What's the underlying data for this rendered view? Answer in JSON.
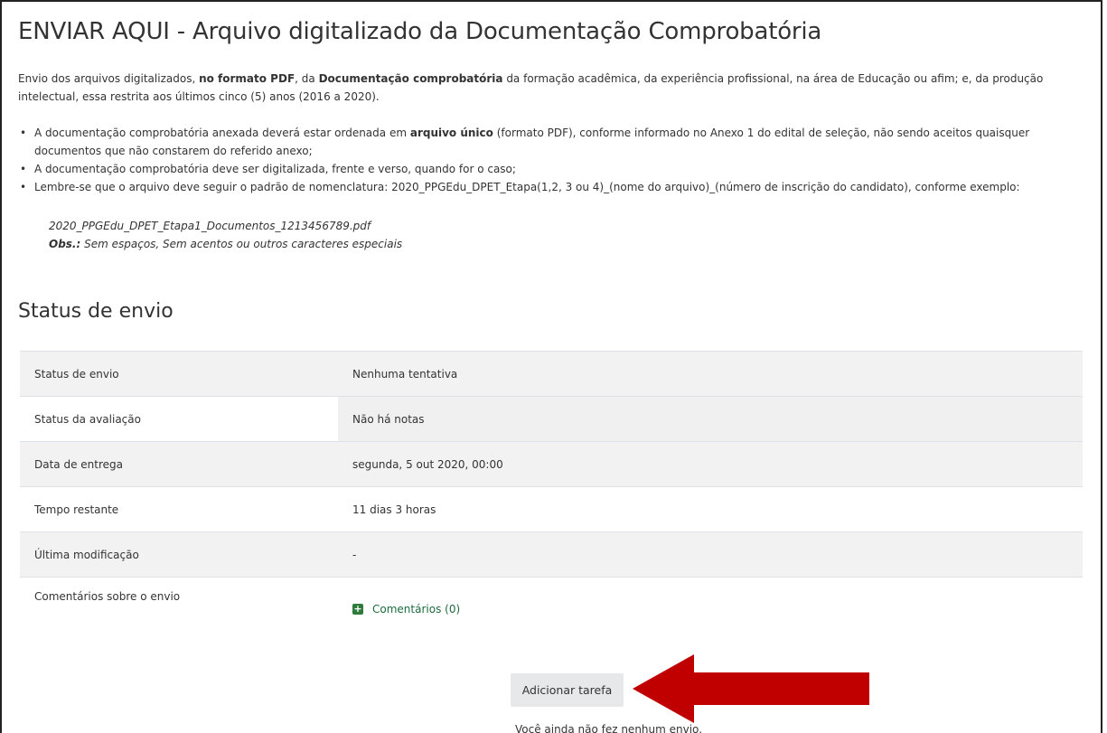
{
  "page": {
    "title": "ENVIAR AQUI - Arquivo digitalizado da Documentação Comprobatória"
  },
  "intro": {
    "part1": "Envio dos arquivos digitalizados, ",
    "bold1": "no formato PDF",
    "part2": ", da ",
    "bold2": "Documentação comprobatória",
    "part3": " da formação acadêmica, da experiência profissional, na área de Educação ou afim; e, da produção intelectual, essa restrita aos últimos cinco (5) anos (2016 a 2020)."
  },
  "bullets": {
    "b1_part1": "A documentação comprobatória anexada deverá estar ordenada em ",
    "b1_bold": "arquivo único",
    "b1_part2": " (formato PDF), conforme informado no Anexo 1 do edital de seleção, não sendo aceitos quaisquer documentos que não constarem do referido anexo;",
    "b2": "A documentação comprobatória deve ser digitalizada, frente e verso, quando for o caso;",
    "b3": "Lembre-se que o arquivo deve seguir o padrão de nomenclatura: 2020_PPGEdu_DPET_Etapa(1,2, 3 ou 4)_(nome do arquivo)_(número de inscrição do candidato), conforme exemplo:"
  },
  "example": {
    "filename": "2020_PPGEdu_DPET_Etapa1_Documentos_1213456789.pdf",
    "obs_label": "Obs.:",
    "obs_text": " Sem espaços, Sem acentos ou outros caracteres especiais"
  },
  "status": {
    "heading": "Status de envio",
    "rows": [
      {
        "label": "Status de envio",
        "value": "Nenhuma tentativa"
      },
      {
        "label": "Status da avaliação",
        "value": "Não há notas"
      },
      {
        "label": "Data de entrega",
        "value": "segunda, 5 out 2020, 00:00"
      },
      {
        "label": "Tempo restante",
        "value": "11 dias 3 horas"
      },
      {
        "label": "Última modificação",
        "value": "-"
      },
      {
        "label": "Comentários sobre o envio",
        "value": "Comentários (0)"
      }
    ]
  },
  "actions": {
    "add_button": "Adicionar tarefa",
    "no_submission": "Você ainda não fez nenhum envio."
  },
  "colors": {
    "arrow": "#c00000",
    "comment_icon": "#2d7a3a"
  },
  "icons": {
    "comment": "plus-square-icon",
    "annotation": "arrow-left-icon"
  }
}
